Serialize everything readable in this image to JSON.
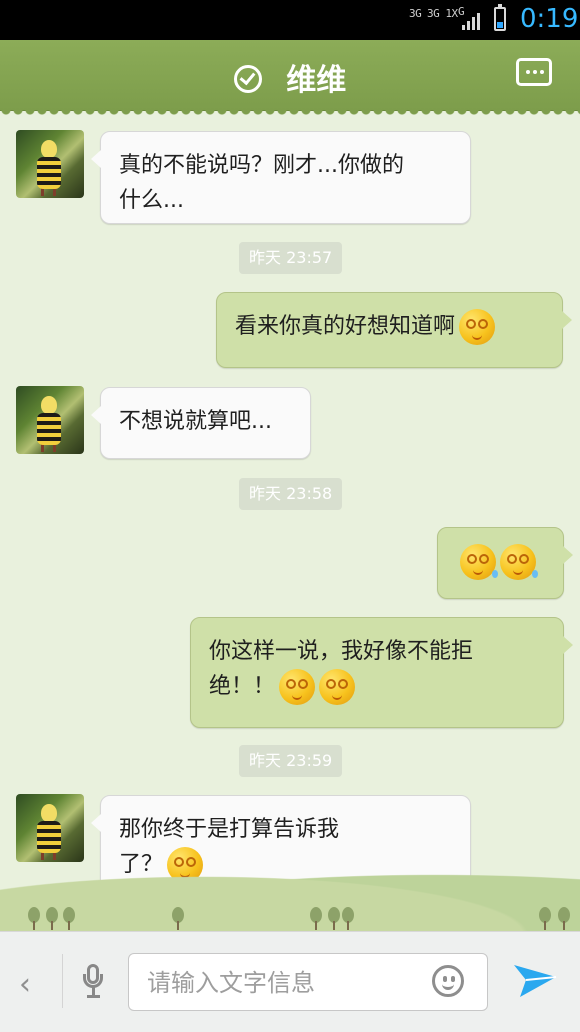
{
  "status_bar": {
    "network_left": "3G",
    "network_mid": "3G 1X",
    "network_right": "G",
    "time": "0:19",
    "battery_level": 0.25,
    "icons": [
      "network-icon",
      "signal-icon",
      "battery-icon"
    ]
  },
  "header": {
    "title": "维维",
    "verified_icon": "check-circle-icon",
    "menu_icon": "more-icon"
  },
  "messages": [
    {
      "side": "left",
      "text_line1": "真的不能说吗？刚才...你做的",
      "text_line2": "什么..."
    },
    {
      "type": "time",
      "text": "昨天 23:57"
    },
    {
      "side": "right",
      "text": "看来你真的好想知道啊",
      "emoji": "dizzy-face-emoji"
    },
    {
      "side": "left",
      "text": "不想说就算吧..."
    },
    {
      "type": "time",
      "text": "昨天 23:58"
    },
    {
      "side": "right",
      "emoji_pair": [
        "sweat-face-emoji",
        "sweat-face-emoji"
      ]
    },
    {
      "side": "right",
      "text_line1": "你这样一说，我好像不能拒",
      "text_line2": "绝！！",
      "emoji_pair": [
        "dizzy-face-emoji",
        "dizzy-face-emoji"
      ]
    },
    {
      "type": "time",
      "text": "昨天 23:59"
    },
    {
      "side": "left",
      "text_line1": "那你终于是打算告诉我",
      "text_line2": "了？",
      "emoji": "pleading-face-emoji"
    }
  ],
  "input_bar": {
    "back_icon": "chevron-left-icon",
    "voice_icon": "microphone-icon",
    "placeholder": "请输入文字信息",
    "emoji_icon": "smiley-icon",
    "send_icon": "send-icon"
  },
  "colors": {
    "header": "#7d9d4b",
    "chat_background": "#e9f1dd",
    "sent_bubble": "#cfe0a8",
    "received_bubble": "#fafafa",
    "status_time": "#37b9ff"
  }
}
